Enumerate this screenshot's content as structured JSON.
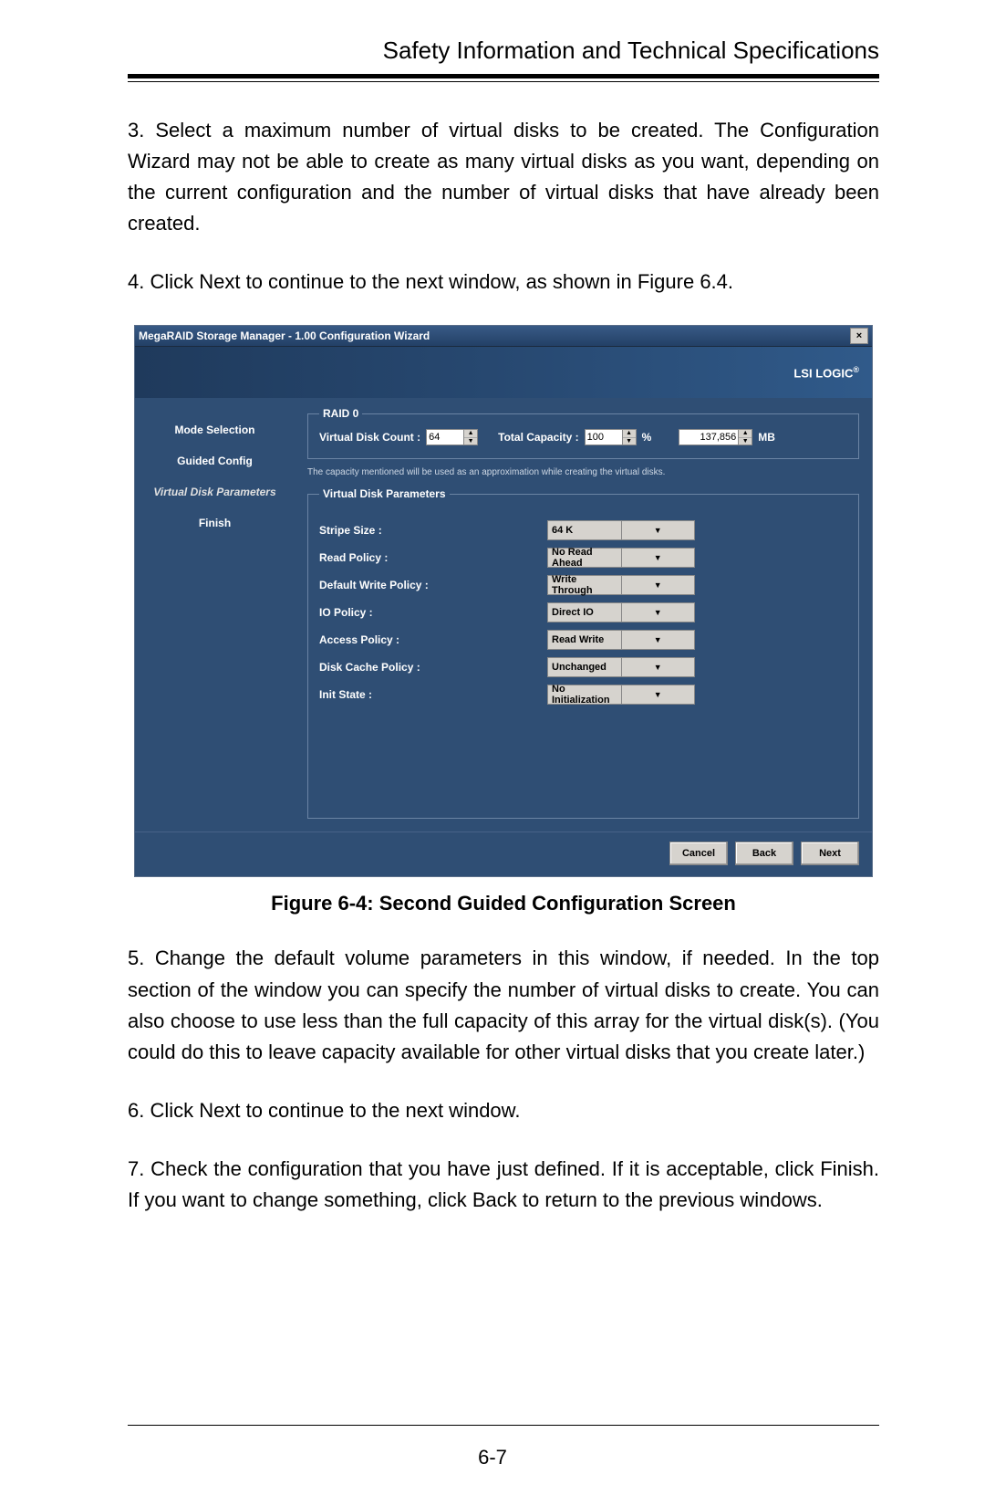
{
  "header": {
    "title": "Safety Information and Technical Specifications"
  },
  "para3": "3. Select a maximum number of virtual disks to be created. The Configuration Wizard may not be able to create as many virtual disks as you want, depending on the current configuration and the number of virtual disks that have already been created.",
  "para4": "4. Click Next to continue to the next window, as shown in Figure 6.4.",
  "figcaption": "Figure 6-4: Second Guided Configuration Screen",
  "para5": "5. Change the default volume parameters in this window, if needed. In the top section of the window you can specify the number of virtual disks to create. You can also choose to use less than the full capacity of this array for the virtual disk(s). (You could do this to leave capacity available for other virtual disks that you create later.)",
  "para6": "6. Click Next to continue to the next window.",
  "para7": "7. Check the configuration that you have just defined. If it is acceptable, click Finish. If you want to change something, click Back to return to the previous windows.",
  "pagenum": "6-7",
  "win": {
    "title": "MegaRAID Storage Manager - 1.00 Configuration Wizard",
    "close": "×",
    "brand": "LSI LOGIC",
    "reg": "®",
    "sidebar": {
      "items": [
        {
          "label": "Mode Selection"
        },
        {
          "label": "Guided Config"
        },
        {
          "label": "Virtual Disk Parameters"
        },
        {
          "label": "Finish"
        }
      ]
    },
    "raid": {
      "legend": "RAID 0",
      "vd_label": "Virtual Disk Count :",
      "vd_value": "64",
      "tc_label": "Total Capacity :",
      "tc_value": "100",
      "pct": "%",
      "mb_value": "137,856",
      "mb_unit": "MB",
      "note": "The capacity mentioned will be used as an approximation while creating the virtual disks."
    },
    "vdp": {
      "legend": "Virtual Disk Parameters",
      "rows": [
        {
          "label": "Stripe Size :",
          "value": "64 K"
        },
        {
          "label": "Read Policy :",
          "value": "No Read Ahead"
        },
        {
          "label": "Default Write Policy :",
          "value": "Write Through"
        },
        {
          "label": "IO Policy :",
          "value": "Direct IO"
        },
        {
          "label": "Access Policy :",
          "value": "Read Write"
        },
        {
          "label": "Disk Cache Policy :",
          "value": "Unchanged"
        },
        {
          "label": "Init State :",
          "value": "No Initialization"
        }
      ]
    },
    "buttons": {
      "cancel": "Cancel",
      "back": "Back",
      "next": "Next"
    }
  }
}
